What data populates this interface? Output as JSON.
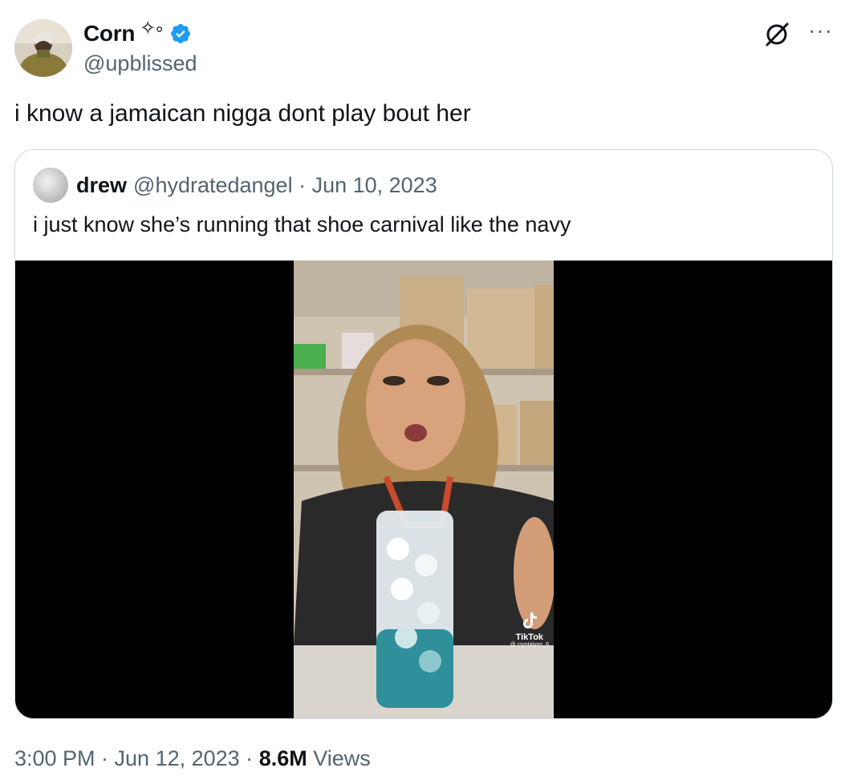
{
  "author": {
    "name": "Corn",
    "name_glyphs": "✧༚",
    "handle": "@upblissed",
    "verified_color": "#1d9bf0"
  },
  "tweet": {
    "text": "i know a jamaican nigga dont play bout her"
  },
  "quote": {
    "name": "drew",
    "meta": "@hydratedangel · Jun 10, 2023",
    "text": "i just know she’s running that shoe carnival like the navy",
    "media": {
      "watermark": "TikTok",
      "watermark_handle": "@ crystalynn_6"
    }
  },
  "footer": {
    "time": "3:00 PM · Jun 12, 2023 · ",
    "views_count": "8.6M",
    "views_label": " Views"
  },
  "icons": [
    "grok-icon",
    "more-icon",
    "verified-badge-icon",
    "tiktok-icon"
  ]
}
